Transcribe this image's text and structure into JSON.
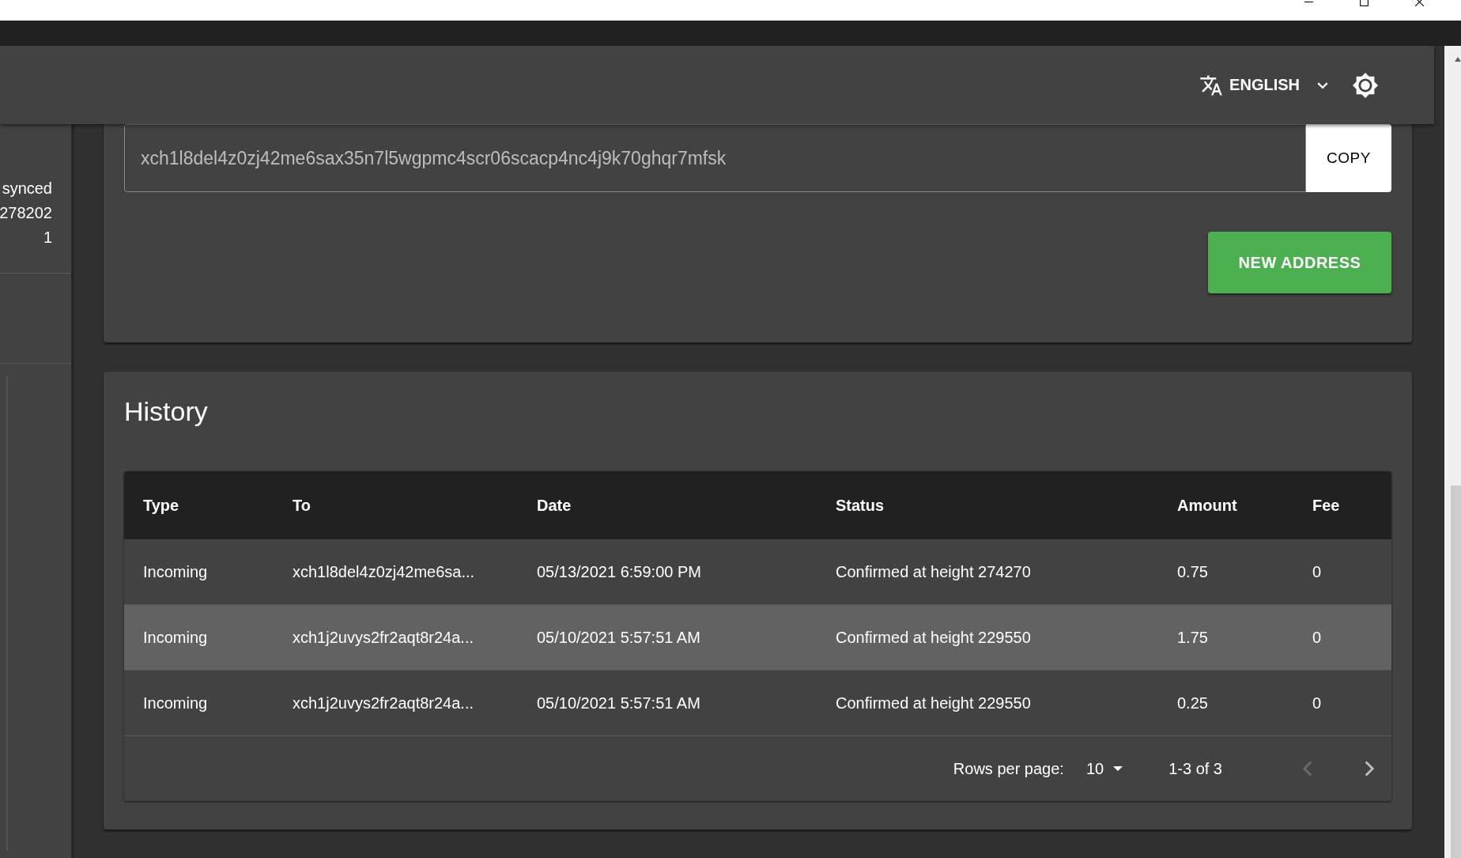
{
  "app_bar": {
    "language": "ENGLISH"
  },
  "sidebar": {
    "lines": [
      "synced",
      "278202",
      "1"
    ]
  },
  "receive": {
    "address": "xch1l8del4z0zj42me6sax35n7l5wgpmc4scr06scacp4nc4j9k70ghqr7mfsk",
    "copy_button": "COPY",
    "new_address_button": "NEW ADDRESS"
  },
  "history": {
    "title": "History",
    "table": {
      "columns": [
        "Type",
        "To",
        "Date",
        "Status",
        "Amount",
        "Fee"
      ],
      "rows": [
        {
          "cells": [
            "Incoming",
            "xch1l8del4z0zj42me6sa...",
            "05/13/2021 6:59:00 PM",
            "Confirmed at height 274270",
            "0.75",
            "0"
          ],
          "highlighted": false
        },
        {
          "cells": [
            "Incoming",
            "xch1j2uvys2fr2aqt8r24a...",
            "05/10/2021 5:57:51 AM",
            "Confirmed at height 229550",
            "1.75",
            "0"
          ],
          "highlighted": true
        },
        {
          "cells": [
            "Incoming",
            "xch1j2uvys2fr2aqt8r24a...",
            "05/10/2021 5:57:51 AM",
            "Confirmed at height 229550",
            "0.25",
            "0"
          ],
          "highlighted": false
        }
      ]
    },
    "pagination": {
      "rows_per_page_label": "Rows per page:",
      "rows_per_page": "10",
      "range": "1-3 of 3",
      "previous_disabled": true,
      "next_disabled": false
    }
  }
}
